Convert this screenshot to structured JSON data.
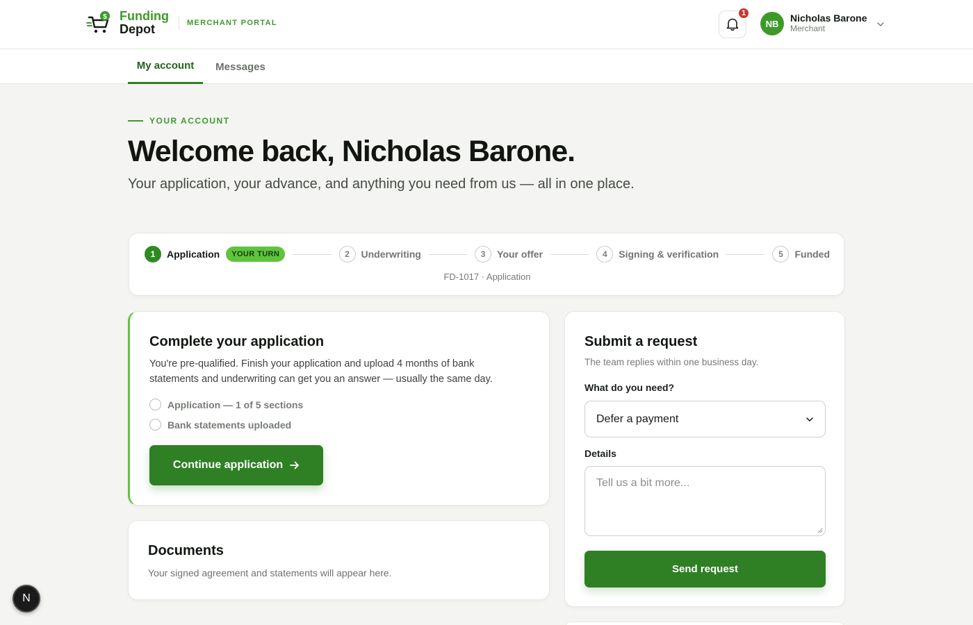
{
  "header": {
    "logo_line1": "Funding",
    "logo_line2": "Depot",
    "portal_label": "MERCHANT PORTAL",
    "notification_count": "1",
    "user": {
      "initials": "NB",
      "name": "Nicholas Barone",
      "role": "Merchant"
    }
  },
  "tabs": [
    {
      "label": "My account",
      "active": true
    },
    {
      "label": "Messages",
      "active": false
    }
  ],
  "hero": {
    "eyebrow": "YOUR ACCOUNT",
    "title": "Welcome back, Nicholas Barone.",
    "subtitle": "Your application, your advance, and anything you need from us — all in one place."
  },
  "progress": {
    "steps": [
      {
        "num": "1",
        "label": "Application",
        "badge": "YOUR TURN",
        "active": true
      },
      {
        "num": "2",
        "label": "Underwriting"
      },
      {
        "num": "3",
        "label": "Your offer"
      },
      {
        "num": "4",
        "label": "Signing & verification"
      },
      {
        "num": "5",
        "label": "Funded"
      }
    ],
    "reference": "FD-1017 · Application"
  },
  "application": {
    "title": "Complete your application",
    "description": "You're pre-qualified. Finish your application and upload 4 months of bank statements and underwriting can get you an answer — usually the same day.",
    "checklist": [
      "Application — 1 of 5 sections",
      "Bank statements uploaded"
    ],
    "button_label": "Continue application"
  },
  "documents": {
    "title": "Documents",
    "description": "Your signed agreement and statements will appear here."
  },
  "request": {
    "title": "Submit a request",
    "subtitle": "The team replies within one business day.",
    "need_label": "What do you need?",
    "need_value": "Defer a payment",
    "details_label": "Details",
    "details_placeholder": "Tell us a bit more...",
    "button_label": "Send request"
  },
  "fab_label": "N",
  "colors": {
    "brand_green": "#3d9a2a",
    "button_green": "#2f7f24",
    "badge_green": "#5ec43e",
    "alert_red": "#c9372c"
  }
}
